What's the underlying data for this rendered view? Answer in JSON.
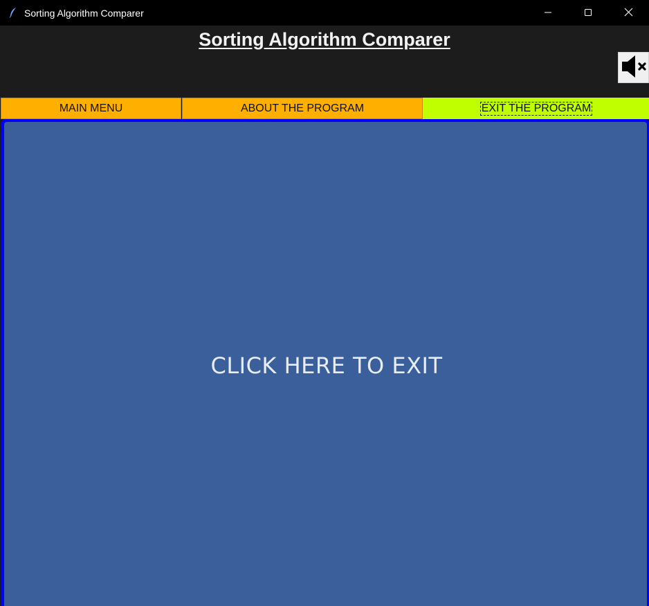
{
  "window": {
    "title": "Sorting Algorithm Comparer",
    "app_icon": "feather-icon",
    "controls": {
      "minimize_icon": "minimize-icon",
      "maximize_icon": "maximize-icon",
      "close_icon": "close-icon"
    }
  },
  "header": {
    "heading": "Sorting Algorithm Comparer",
    "mute_icon": "speaker-muted-icon"
  },
  "tabs": [
    {
      "label": "MAIN MENU",
      "color": "#ffaf00"
    },
    {
      "label": "ABOUT THE PROGRAM",
      "color": "#ffaf00"
    },
    {
      "label": "EXIT THE PROGRAM",
      "color": "#bfff00",
      "selected": true
    }
  ],
  "main": {
    "exit_button_label": "CLICK HERE TO EXIT",
    "panel_color": "#3a5f9a",
    "border_color": "#0000ff"
  }
}
